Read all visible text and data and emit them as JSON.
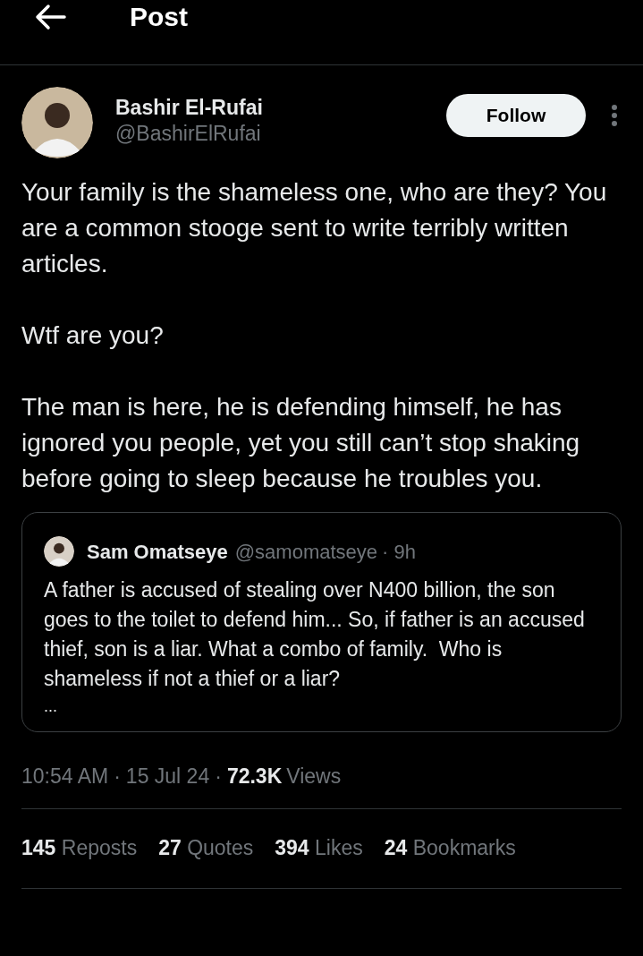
{
  "header": {
    "title": "Post"
  },
  "post": {
    "author": {
      "name": "Bashir El-Rufai",
      "handle": "@BashirElRufai"
    },
    "follow_button": "Follow",
    "paragraphs": [
      "Your family is the shameless one, who are they? You are a common stooge sent to write terribly written articles.",
      "Wtf are you?",
      "The man is here, he is defending himself, he has ignored you people, yet you still can’t stop shaking before going to sleep because he troubles you."
    ],
    "quoted": {
      "name": "Sam Omatseye",
      "handle": "@samomatseye",
      "age": "· 9h",
      "text": "A father is accused of stealing over N400 billion, the son goes to the toilet to defend him... So, if father is an accused thief, son is a liar. What a combo of family.  Who is shameless if not a thief or a liar?",
      "more": "..."
    },
    "time": "10:54 AM",
    "separator": "·",
    "date": "15 Jul 24",
    "views_count": "72.3K",
    "views_label": "Views",
    "stats": [
      {
        "count": "145",
        "label": "Reposts"
      },
      {
        "count": "27",
        "label": "Quotes"
      },
      {
        "count": "394",
        "label": "Likes"
      },
      {
        "count": "24",
        "label": "Bookmarks"
      }
    ]
  }
}
